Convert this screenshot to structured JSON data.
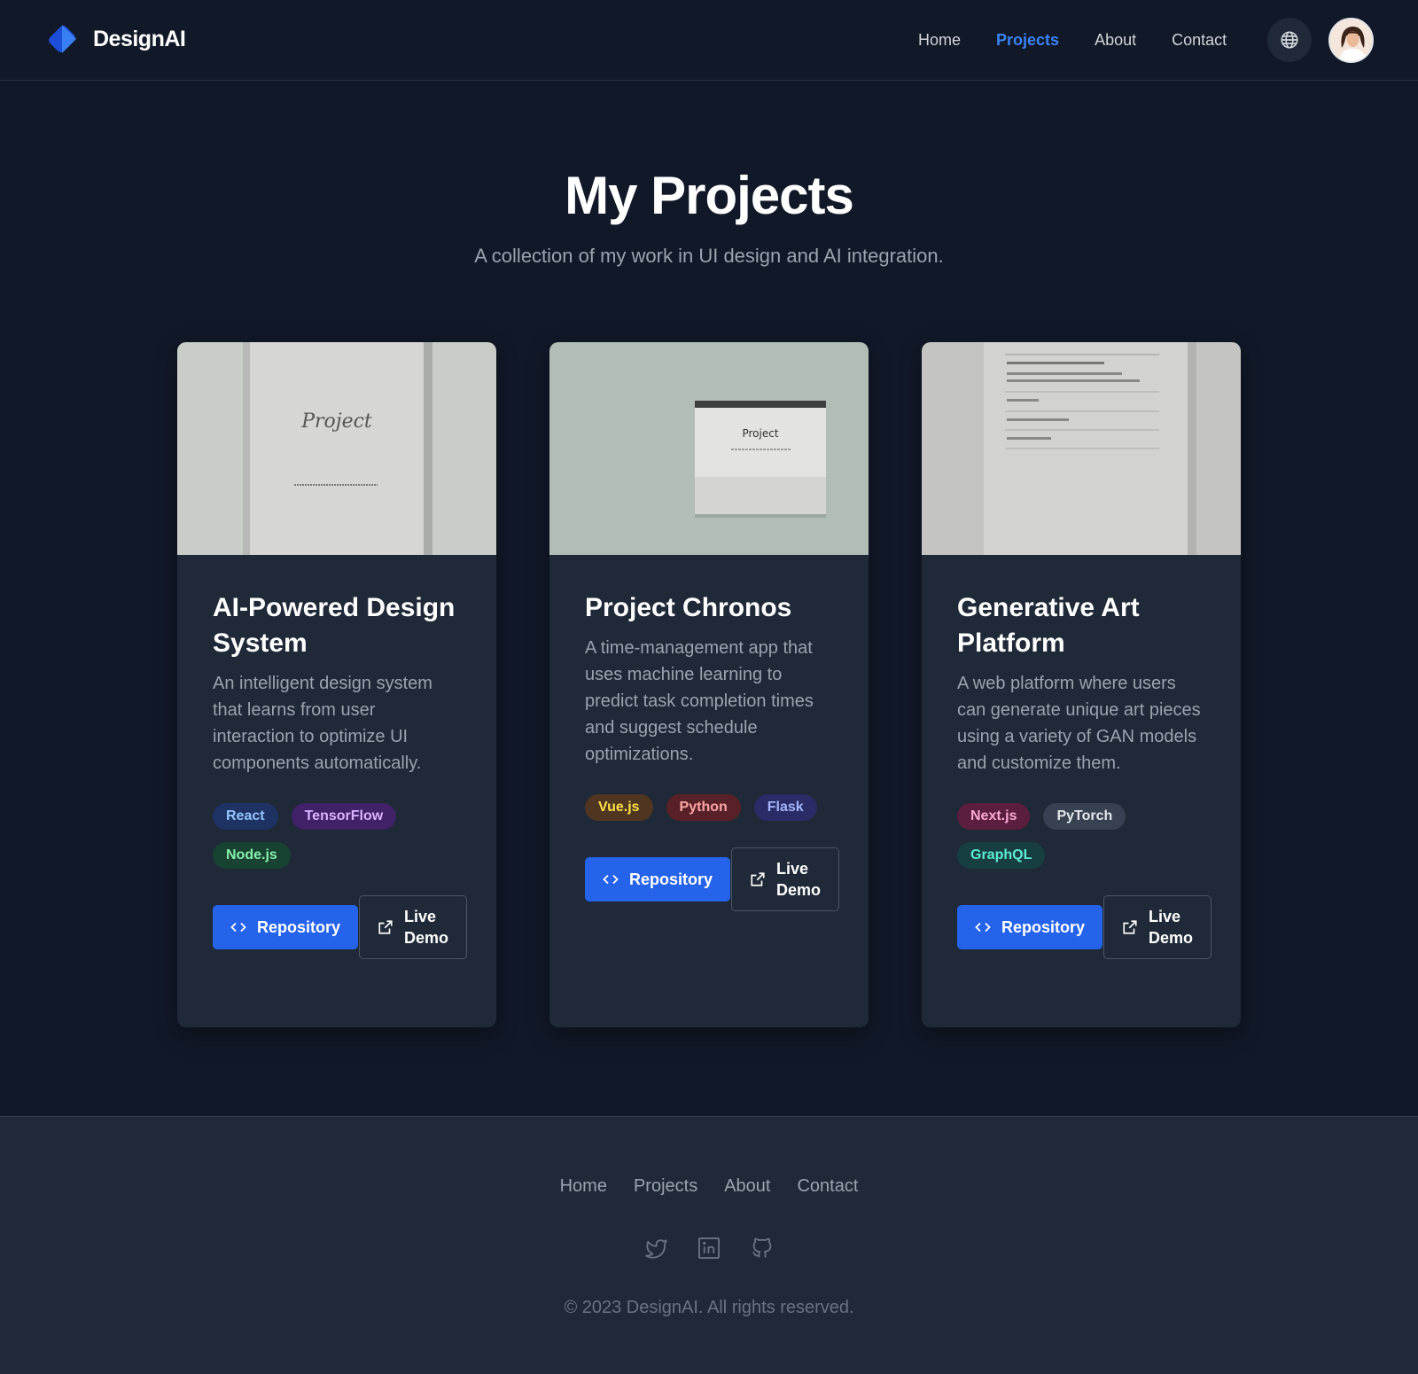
{
  "header": {
    "brand": "DesignAI",
    "nav": [
      "Home",
      "Projects",
      "About",
      "Contact"
    ],
    "active_nav": "Projects"
  },
  "hero": {
    "title": "My Projects",
    "subtitle": "A collection of my work in UI design and AI integration."
  },
  "projects": [
    {
      "title": "AI-Powered Design System",
      "description": "An intelligent design system that learns from user interaction to optimize UI components automatically.",
      "image_text": "Project",
      "tags": [
        "React",
        "TensorFlow",
        "Node.js"
      ],
      "repo_label": "Repository",
      "demo_label": "Live Demo"
    },
    {
      "title": "Project Chronos",
      "description": "A time-management app that uses machine learning to predict task completion times and suggest schedule optimizations.",
      "image_text": "Project",
      "tags": [
        "Vue.js",
        "Python",
        "Flask"
      ],
      "repo_label": "Repository",
      "demo_label": "Live Demo"
    },
    {
      "title": "Generative Art Platform",
      "description": "A web platform where users can generate unique art pieces using a variety of GAN models and customize them.",
      "tags": [
        "Next.js",
        "PyTorch",
        "GraphQL"
      ],
      "repo_label": "Repository",
      "demo_label": "Live Demo"
    }
  ],
  "footer": {
    "nav": [
      "Home",
      "Projects",
      "About",
      "Contact"
    ],
    "social_icons": [
      "twitter-icon",
      "linkedin-icon",
      "github-icon"
    ],
    "copyright": "© 2023 DesignAI. All rights reserved."
  },
  "colors": {
    "background": "#111827",
    "surface": "#1f2937",
    "accent": "#3b82f6",
    "button": "#2563eb"
  }
}
